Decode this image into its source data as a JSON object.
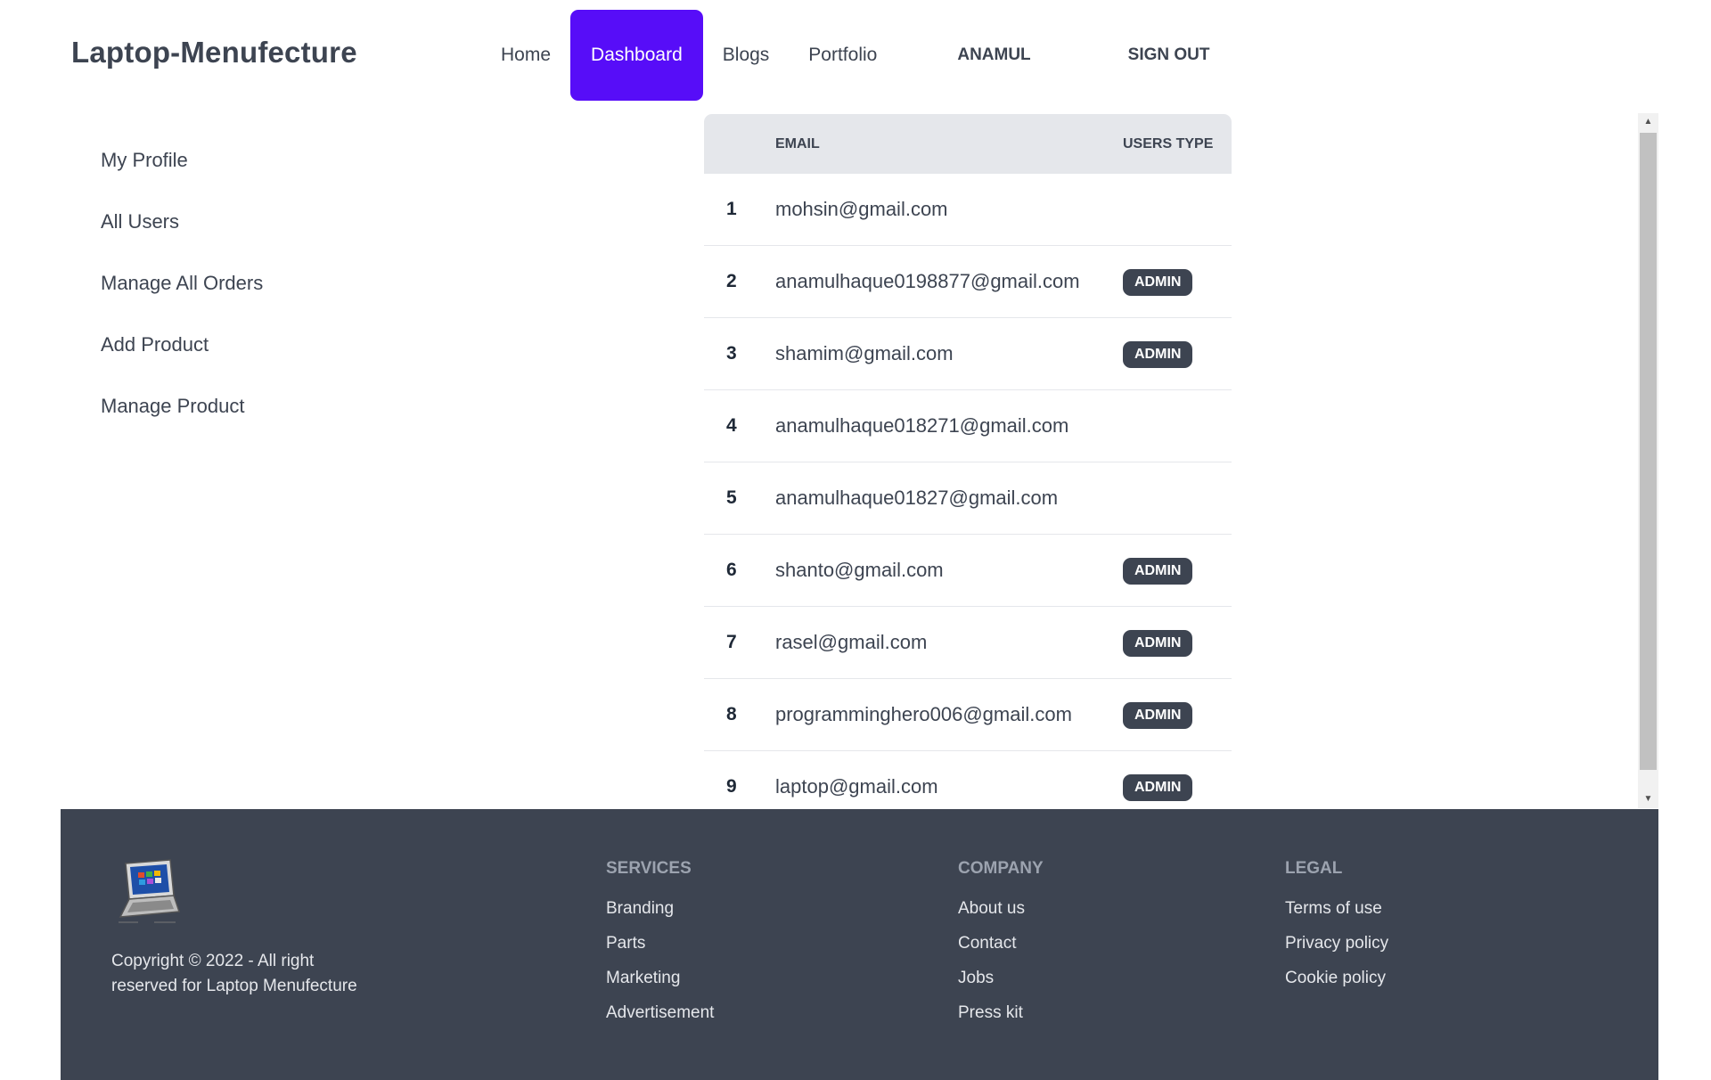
{
  "brand": {
    "name": "Laptop-Menufecture"
  },
  "nav": {
    "home": "Home",
    "dashboard": "Dashboard",
    "blogs": "Blogs",
    "portfolio": "Portfolio",
    "user": "ANAMUL",
    "signout": "SIGN OUT"
  },
  "sidebar": {
    "items": [
      {
        "label": "My Profile"
      },
      {
        "label": "All Users"
      },
      {
        "label": "Manage All Orders"
      },
      {
        "label": "Add Product"
      },
      {
        "label": "Manage Product"
      }
    ]
  },
  "table": {
    "headers": {
      "num": "",
      "email": "Email",
      "type": "Users Type"
    },
    "rows": [
      {
        "num": "1",
        "email": "mohsin@gmail.com",
        "role": ""
      },
      {
        "num": "2",
        "email": "anamulhaque0198877@gmail.com",
        "role": "admin"
      },
      {
        "num": "3",
        "email": "shamim@gmail.com",
        "role": "admin"
      },
      {
        "num": "4",
        "email": "anamulhaque018271@gmail.com",
        "role": ""
      },
      {
        "num": "5",
        "email": "anamulhaque01827@gmail.com",
        "role": ""
      },
      {
        "num": "6",
        "email": "shanto@gmail.com",
        "role": "admin"
      },
      {
        "num": "7",
        "email": "rasel@gmail.com",
        "role": "admin"
      },
      {
        "num": "8",
        "email": "programminghero006@gmail.com",
        "role": "admin"
      },
      {
        "num": "9",
        "email": "laptop@gmail.com",
        "role": "admin"
      }
    ]
  },
  "footer": {
    "copyright_line1": "Copyright © 2022 - All right",
    "copyright_line2": "reserved for Laptop Menufecture",
    "services": {
      "title": "Services",
      "links": [
        "Branding",
        "Parts",
        "Marketing",
        "Advertisement"
      ]
    },
    "company": {
      "title": "Company",
      "links": [
        "About us",
        "Contact",
        "Jobs",
        "Press kit"
      ]
    },
    "legal": {
      "title": "Legal",
      "links": [
        "Terms of use",
        "Privacy policy",
        "Cookie policy"
      ]
    }
  },
  "icons": {
    "scroll_up": "triangle-up-icon",
    "scroll_down": "triangle-down-icon",
    "logo": "laptop-logo-icon"
  },
  "colors": {
    "accent": "#570df8",
    "neutral": "#3d4451",
    "header_bg": "#e5e7eb"
  }
}
